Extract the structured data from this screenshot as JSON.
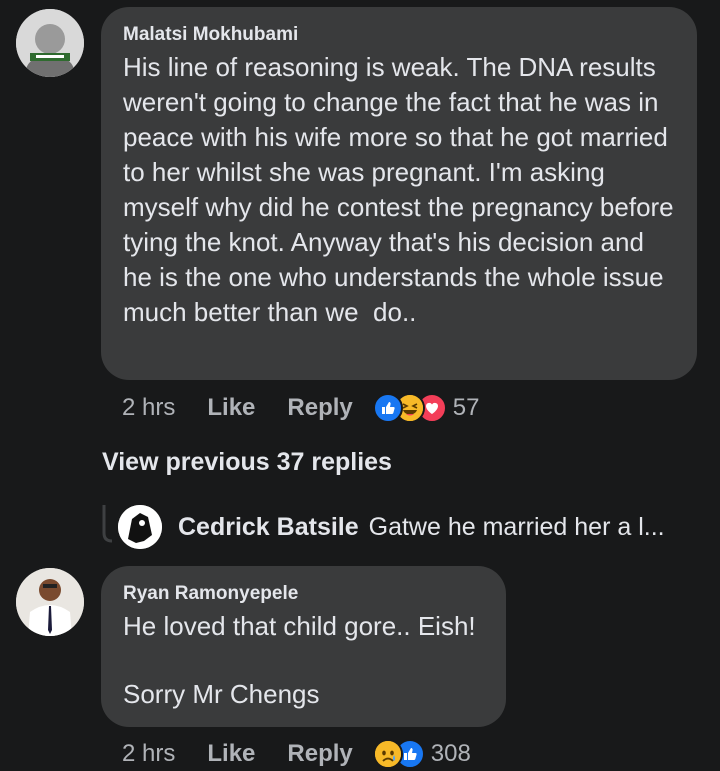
{
  "comments": [
    {
      "author": "Malatsi Mokhubami",
      "text": "His line of reasoning is weak. The DNA results weren't going to change the fact that he was in peace with his wife more so that he got married to her whilst she was pregnant. I'm asking myself why did he contest the pregnancy before tying the knot. Anyway that's his decision and he is the one who understands the whole issue much better than we  do..",
      "time": "2 hrs",
      "like_label": "Like",
      "reply_label": "Reply",
      "reactions": [
        "like-icon",
        "laugh-icon",
        "love-icon"
      ],
      "reaction_count": "57"
    },
    {
      "author": "Ryan Ramonyepele",
      "text": "He loved that child gore.. Eish!\n\nSorry Mr Chengs",
      "time": "2 hrs",
      "like_label": "Like",
      "reply_label": "Reply",
      "reactions": [
        "sad-icon",
        "like-icon"
      ],
      "reaction_count": "308"
    }
  ],
  "view_previous": "View previous 37 replies",
  "reply_preview": {
    "author": "Cedrick Batsile",
    "text": "Gatwe he married her a l..."
  },
  "colors": {
    "background": "#18191a",
    "bubble": "#3a3b3c",
    "primary_text": "#e4e6eb",
    "secondary_text": "#b0b3b8",
    "like_blue": "#1877f2",
    "love_red": "#f33e58",
    "emoji_yellow": "#f7b928"
  }
}
